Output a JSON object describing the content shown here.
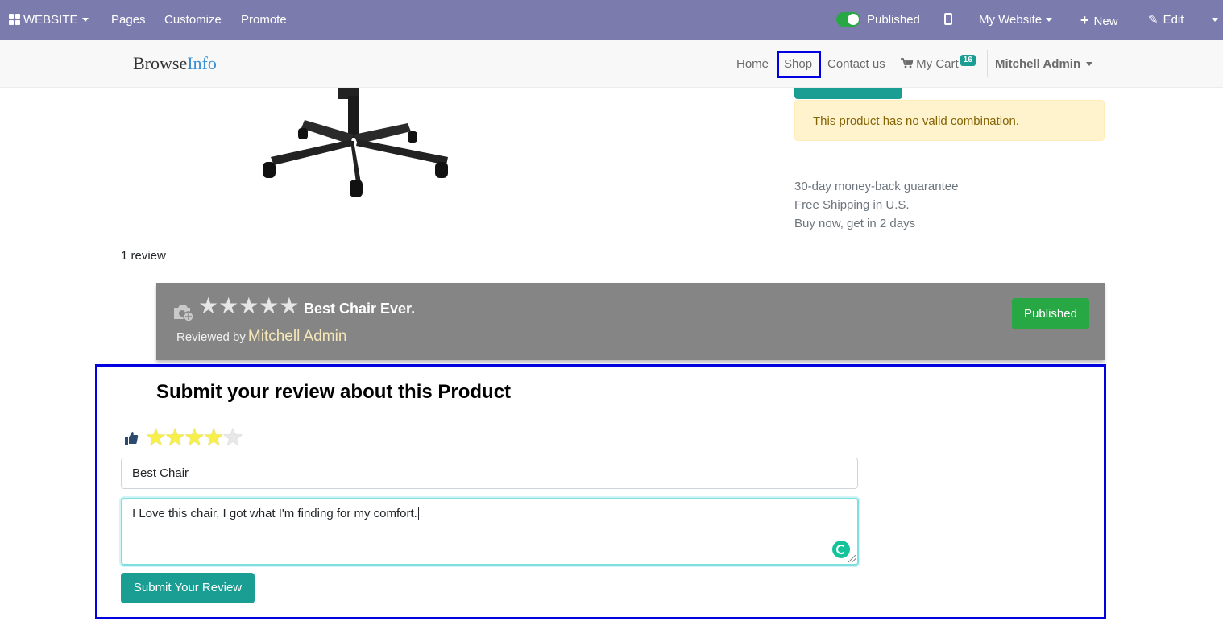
{
  "topbar": {
    "website_label": "WEBSITE",
    "pages_label": "Pages",
    "customize_label": "Customize",
    "promote_label": "Promote",
    "published_label": "Published",
    "my_website_label": "My Website",
    "new_label": "New",
    "edit_label": "Edit",
    "bg_color": "#7c7bad"
  },
  "navbar": {
    "brand_part1": "Browse",
    "brand_part2": "Info",
    "home": "Home",
    "shop": "Shop",
    "contact": "Contact us",
    "cart": "My Cart",
    "cart_count": "16",
    "user": "Mitchell Admin"
  },
  "product": {
    "alert_text": "This product has no valid combination.",
    "features": [
      "30-day money-back guarantee",
      "Free Shipping in U.S.",
      "Buy now, get in 2 days"
    ]
  },
  "reviews": {
    "count_text": "1 review",
    "items": [
      {
        "stars": "★★★★★",
        "title": "Best Chair Ever.",
        "reviewed_by_label": "Reviewed by",
        "author": "Mitchell Admin",
        "status_button": "Published"
      }
    ]
  },
  "submit_review": {
    "heading": "Submit your review about this Product",
    "rating": 4,
    "rating_max": 5,
    "title_value": "Best Chair",
    "body_value": "I Love this chair,  I got what I'm finding for my comfort.",
    "submit_label": "Submit Your Review"
  },
  "colors": {
    "accent_teal": "#1a9e93",
    "success_green": "#28a745",
    "highlight_blue": "#0000e0"
  }
}
